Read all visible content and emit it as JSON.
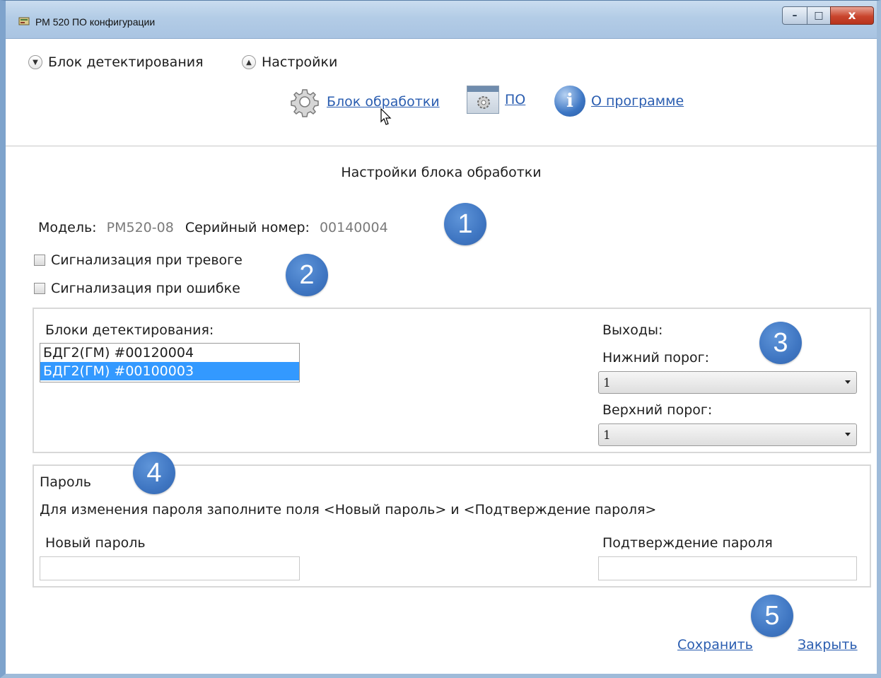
{
  "window": {
    "title": "РМ 520 ПО конфигурации",
    "controls": {
      "minimize": "–",
      "maximize": "□",
      "close": "x"
    }
  },
  "expanders": [
    {
      "label": "Блок детектирования",
      "state": "collapsed",
      "icon": "chevron-down-icon"
    },
    {
      "label": "Настройки",
      "state": "expanded",
      "icon": "chevron-up-icon"
    }
  ],
  "nav": {
    "processing_block": {
      "label": "Блок обработки",
      "icon": "gear-icon"
    },
    "software": {
      "label": "ПО",
      "icon": "window-gear-icon"
    },
    "about": {
      "label": "О программе",
      "icon": "info-icon"
    }
  },
  "settings": {
    "title": "Настройки блока обработки",
    "model_label": "Модель:",
    "model_value": "PM520-08",
    "serial_label": "Серийный номер:",
    "serial_value": "00140004",
    "alarm_signal": {
      "label": "Сигнализация при тревоге",
      "checked": false
    },
    "error_signal": {
      "label": "Сигнализация при ошибке",
      "checked": false
    }
  },
  "detection": {
    "label": "Блоки детектирования:",
    "items": [
      {
        "text": "БДГ2(ГМ) #00120004",
        "selected": false
      },
      {
        "text": "БДГ2(ГМ) #00100003",
        "selected": true
      }
    ]
  },
  "outputs": {
    "label": "Выходы:",
    "lower_label": "Нижний порог:",
    "lower_value": "1",
    "upper_label": "Верхний порог:",
    "upper_value": "1"
  },
  "password": {
    "title": "Пароль",
    "hint": "Для изменения пароля заполните поля <Новый пароль> и <Подтверждение пароля>",
    "new_label": "Новый пароль",
    "new_value": "",
    "confirm_label": "Подтверждение пароля",
    "confirm_value": ""
  },
  "footer": {
    "save": "Сохранить",
    "close": "Закрыть"
  },
  "callouts": [
    "1",
    "2",
    "3",
    "4",
    "5"
  ],
  "colors": {
    "link": "#2a5db0",
    "selection": "#3399ff",
    "callout": "#3f76c2",
    "titlebar": "#b3cce6",
    "close_button": "#c9452d"
  }
}
